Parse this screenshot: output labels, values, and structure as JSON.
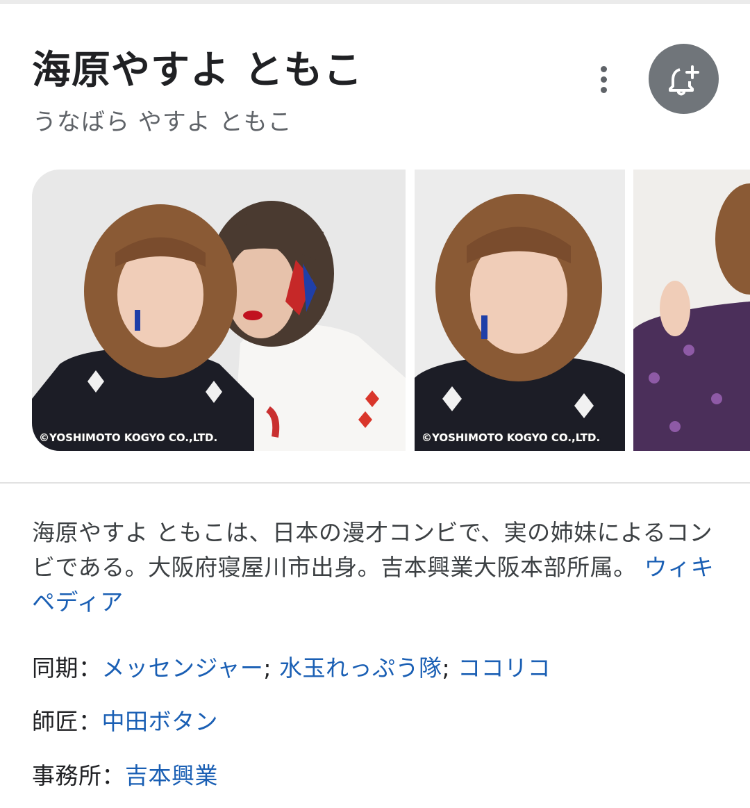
{
  "entity": {
    "title": "海原やすよ ともこ",
    "reading": "うなばら やすよ ともこ"
  },
  "actions": {
    "more_icon": "more-vert-icon",
    "follow_icon": "bell-plus-icon"
  },
  "images": {
    "watermark_1": "©YOSHIMOTO KOGYO CO.,LTD.",
    "watermark_2": "©YOSHIMOTO KOGYO CO.,LTD."
  },
  "description": {
    "text": "海原やすよ ともこは、日本の漫才コンビで、実の姉妹によるコンビである。大阪府寝屋川市出身。吉本興業大阪本部所属。",
    "source_link": "ウィキペディア"
  },
  "facts": {
    "peers": {
      "label": "同期：",
      "links": [
        "メッセンジャー",
        "水玉れっぷう隊",
        "ココリコ"
      ],
      "separator": "; "
    },
    "mentor": {
      "label": "師匠：",
      "link": "中田ボタン"
    },
    "agency": {
      "label": "事務所：",
      "link": "吉本興業"
    }
  },
  "colors": {
    "link": "#1a5fb4",
    "follow_button_bg": "#70757a",
    "secondary_text": "#5f6368"
  }
}
